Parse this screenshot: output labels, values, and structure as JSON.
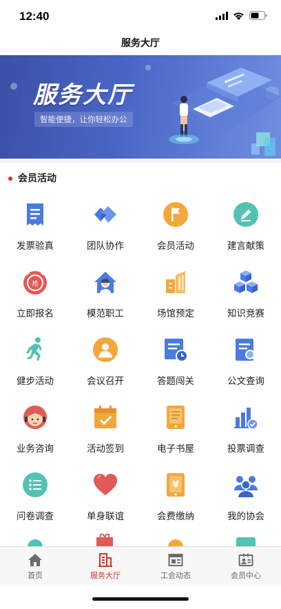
{
  "status_bar": {
    "time": "12:40"
  },
  "nav": {
    "title": "服务大厅"
  },
  "banner": {
    "title": "服务大厅",
    "subtitle": "智能便捷，让你轻松办公"
  },
  "section": {
    "title": "会员活动"
  },
  "grid": [
    {
      "label": "发票验真",
      "icon": "invoice-icon"
    },
    {
      "label": "团队协作",
      "icon": "team-icon"
    },
    {
      "label": "会员活动",
      "icon": "flag-icon"
    },
    {
      "label": "建言献策",
      "icon": "pencil-icon"
    },
    {
      "label": "立即报名",
      "icon": "alarm-clock-icon"
    },
    {
      "label": "模范职工",
      "icon": "worker-house-icon"
    },
    {
      "label": "场馆预定",
      "icon": "building-icon"
    },
    {
      "label": "知识竞赛",
      "icon": "cubes-icon"
    },
    {
      "label": "健步活动",
      "icon": "runner-icon"
    },
    {
      "label": "会议召开",
      "icon": "meeting-icon"
    },
    {
      "label": "答题闯关",
      "icon": "quiz-clock-icon"
    },
    {
      "label": "公文查询",
      "icon": "document-search-icon"
    },
    {
      "label": "业务咨询",
      "icon": "headset-girl-icon"
    },
    {
      "label": "活动签到",
      "icon": "calendar-check-icon"
    },
    {
      "label": "电子书屋",
      "icon": "ebook-icon"
    },
    {
      "label": "投票调查",
      "icon": "vote-chart-icon"
    },
    {
      "label": "问卷调查",
      "icon": "checklist-icon"
    },
    {
      "label": "单身联谊",
      "icon": "heart-icon"
    },
    {
      "label": "会费缴纳",
      "icon": "yen-tablet-icon"
    },
    {
      "label": "我的协会",
      "icon": "association-icon"
    }
  ],
  "grid_icon_value": {
    "yen": "¥",
    "register": "抢"
  },
  "tabs": [
    {
      "label": "首页",
      "icon": "home-icon",
      "active": false
    },
    {
      "label": "服务大厅",
      "icon": "hall-building-icon",
      "active": true
    },
    {
      "label": "工会动态",
      "icon": "news-icon",
      "active": false
    },
    {
      "label": "会员中心",
      "icon": "member-card-icon",
      "active": false
    }
  ],
  "colors": {
    "accent": "#d93025",
    "blue": "#4a7be0",
    "orange": "#f3a73b",
    "teal": "#52c2b3",
    "red": "#e25a57",
    "banner": "#4a67c6"
  }
}
